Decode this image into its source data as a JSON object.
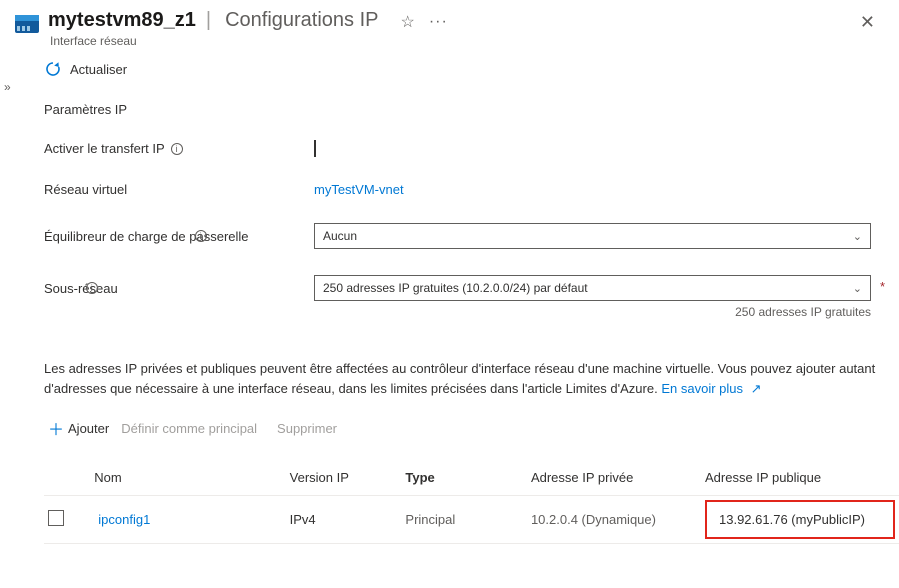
{
  "header": {
    "resource_name": "mytestvm89_z1",
    "section_title": "Configurations IP",
    "subtitle": "Interface réseau"
  },
  "commands": {
    "refresh": "Actualiser"
  },
  "ip_settings": {
    "title": "Paramètres IP",
    "forwarding_label": "Activer le transfert IP",
    "vnet_label": "Réseau virtuel",
    "vnet_value": "myTestVM-vnet",
    "gwlb_label": "Équilibreur de charge de passerelle",
    "gwlb_value": "Aucun",
    "subnet_label": "Sous-réseau",
    "subnet_value": "250 adresses IP gratuites (10.2.0.0/24) par défaut",
    "subnet_hint": "250 adresses IP gratuites"
  },
  "info": {
    "text": "Les adresses IP privées et publiques peuvent être affectées au contrôleur d'interface réseau d'une machine virtuelle. Vous pouvez ajouter autant d'adresses que nécessaire à une interface réseau, dans les limites précisées dans l'article Limites d'Azure.",
    "learn_more": "En savoir plus"
  },
  "actions": {
    "add": "Ajouter",
    "set_primary": "Définir comme principal",
    "delete": "Supprimer"
  },
  "table": {
    "headers": {
      "name": "Nom",
      "version": "Version IP",
      "type": "Type",
      "private": "Adresse IP privée",
      "public": "Adresse IP publique"
    },
    "rows": [
      {
        "name": "ipconfig1",
        "version": "IPv4",
        "type": "Principal",
        "private": "10.2.0.4 (Dynamique)",
        "public": "13.92.61.76 (myPublicIP)"
      }
    ]
  }
}
